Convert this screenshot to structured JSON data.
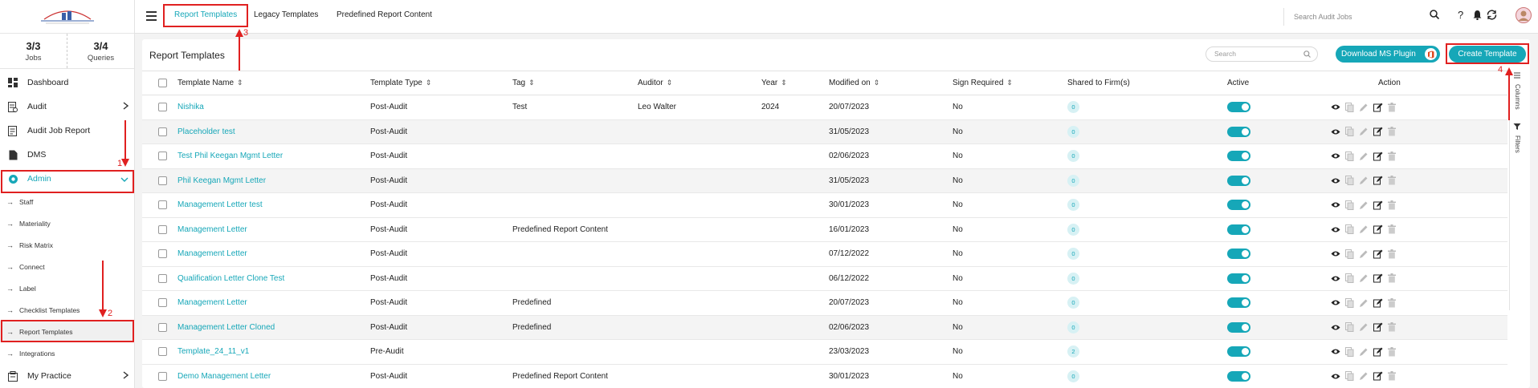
{
  "sidebar": {
    "stats": [
      {
        "value": "3/3",
        "label": "Jobs"
      },
      {
        "value": "3/4",
        "label": "Queries"
      }
    ],
    "nav": [
      {
        "label": "Dashboard",
        "icon": "dashboard-icon"
      },
      {
        "label": "Audit",
        "icon": "audit-icon"
      },
      {
        "label": "Audit Job Report",
        "icon": "report-icon"
      },
      {
        "label": "DMS",
        "icon": "document-icon"
      },
      {
        "label": "Admin",
        "icon": "gear-icon"
      }
    ],
    "admin_items": [
      "Staff",
      "Materiality",
      "Risk Matrix",
      "Connect",
      "Label",
      "Checklist Templates",
      "Report Templates",
      "Integrations"
    ],
    "my_practice": "My Practice"
  },
  "topbar": {
    "tabs": [
      "Report Templates",
      "Legacy Templates",
      "Predefined Report Content"
    ],
    "search_placeholder": "Search Audit Jobs",
    "help": "?"
  },
  "main": {
    "title": "Report Templates",
    "search_placeholder": "Search",
    "download_label": "Download MS Plugin",
    "create_label": "Create Template",
    "columns_label": "Columns",
    "filters_label": "Filters",
    "headers": [
      "Template Name",
      "Template Type",
      "Tag",
      "Auditor",
      "Year",
      "Modified on",
      "Sign Required",
      "Shared to Firm(s)",
      "Active",
      "Action"
    ],
    "rows": [
      {
        "name": "Nishika",
        "type": "Post-Audit",
        "tag": "Test",
        "auditor": "Leo Walter",
        "year": "2024",
        "modified": "20/07/2023",
        "sign": "No",
        "shared": "0"
      },
      {
        "name": "Placeholder test",
        "type": "Post-Audit",
        "tag": "",
        "auditor": "",
        "year": "",
        "modified": "31/05/2023",
        "sign": "No",
        "shared": "0"
      },
      {
        "name": "Test Phil Keegan Mgmt Letter",
        "type": "Post-Audit",
        "tag": "",
        "auditor": "",
        "year": "",
        "modified": "02/06/2023",
        "sign": "No",
        "shared": "0"
      },
      {
        "name": "Phil Keegan Mgmt Letter",
        "type": "Post-Audit",
        "tag": "",
        "auditor": "",
        "year": "",
        "modified": "31/05/2023",
        "sign": "No",
        "shared": "0"
      },
      {
        "name": "Management Letter test",
        "type": "Post-Audit",
        "tag": "",
        "auditor": "",
        "year": "",
        "modified": "30/01/2023",
        "sign": "No",
        "shared": "0"
      },
      {
        "name": "Management Letter",
        "type": "Post-Audit",
        "tag": "Predefined Report Content",
        "auditor": "",
        "year": "",
        "modified": "16/01/2023",
        "sign": "No",
        "shared": "0"
      },
      {
        "name": "Management Letter",
        "type": "Post-Audit",
        "tag": "",
        "auditor": "",
        "year": "",
        "modified": "07/12/2022",
        "sign": "No",
        "shared": "0"
      },
      {
        "name": "Qualification Letter Clone Test",
        "type": "Post-Audit",
        "tag": "",
        "auditor": "",
        "year": "",
        "modified": "06/12/2022",
        "sign": "No",
        "shared": "0"
      },
      {
        "name": "Management Letter",
        "type": "Post-Audit",
        "tag": "Predefined",
        "auditor": "",
        "year": "",
        "modified": "20/07/2023",
        "sign": "No",
        "shared": "0"
      },
      {
        "name": "Management Letter Cloned",
        "type": "Post-Audit",
        "tag": "Predefined",
        "auditor": "",
        "year": "",
        "modified": "02/06/2023",
        "sign": "No",
        "shared": "0"
      },
      {
        "name": "Template_24_11_v1",
        "type": "Pre-Audit",
        "tag": "",
        "auditor": "",
        "year": "",
        "modified": "23/03/2023",
        "sign": "No",
        "shared": "2"
      },
      {
        "name": "Demo Management Letter",
        "type": "Post-Audit",
        "tag": "Predefined Report Content",
        "auditor": "",
        "year": "",
        "modified": "30/01/2023",
        "sign": "No",
        "shared": "0"
      }
    ]
  },
  "annotations": [
    "1",
    "2",
    "3",
    "4"
  ],
  "colors": {
    "accent": "#16a7b8",
    "annotation": "#e02020"
  }
}
